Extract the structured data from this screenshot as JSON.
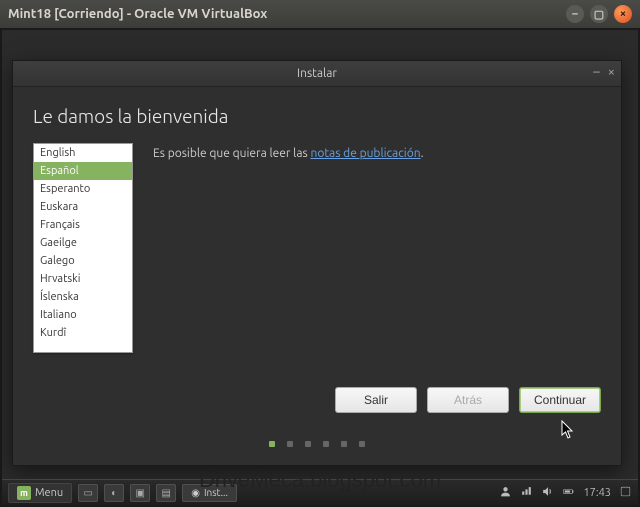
{
  "virtualbox": {
    "title": "Mint18 [Corriendo] - Oracle VM VirtualBox"
  },
  "installer": {
    "title": "Instalar",
    "welcome": "Le damos la bienvenida",
    "message_prefix": "Es posible que quiera leer las ",
    "message_link": "notas de publicación",
    "message_suffix": ".",
    "languages": [
      "English",
      "Español",
      "Esperanto",
      "Euskara",
      "Français",
      "Gaeilge",
      "Galego",
      "Hrvatski",
      "Íslenska",
      "Italiano",
      "Kurdî"
    ],
    "selected_index": 1,
    "buttons": {
      "quit": "Salir",
      "back": "Atrás",
      "continue": "Continuar"
    },
    "dot_count": 6,
    "active_dot": 0
  },
  "taskbar": {
    "menu": "Menu",
    "task_label": "Inst...",
    "clock": "17:43"
  },
  "watermark": "DriveMeca.blogspot.com"
}
